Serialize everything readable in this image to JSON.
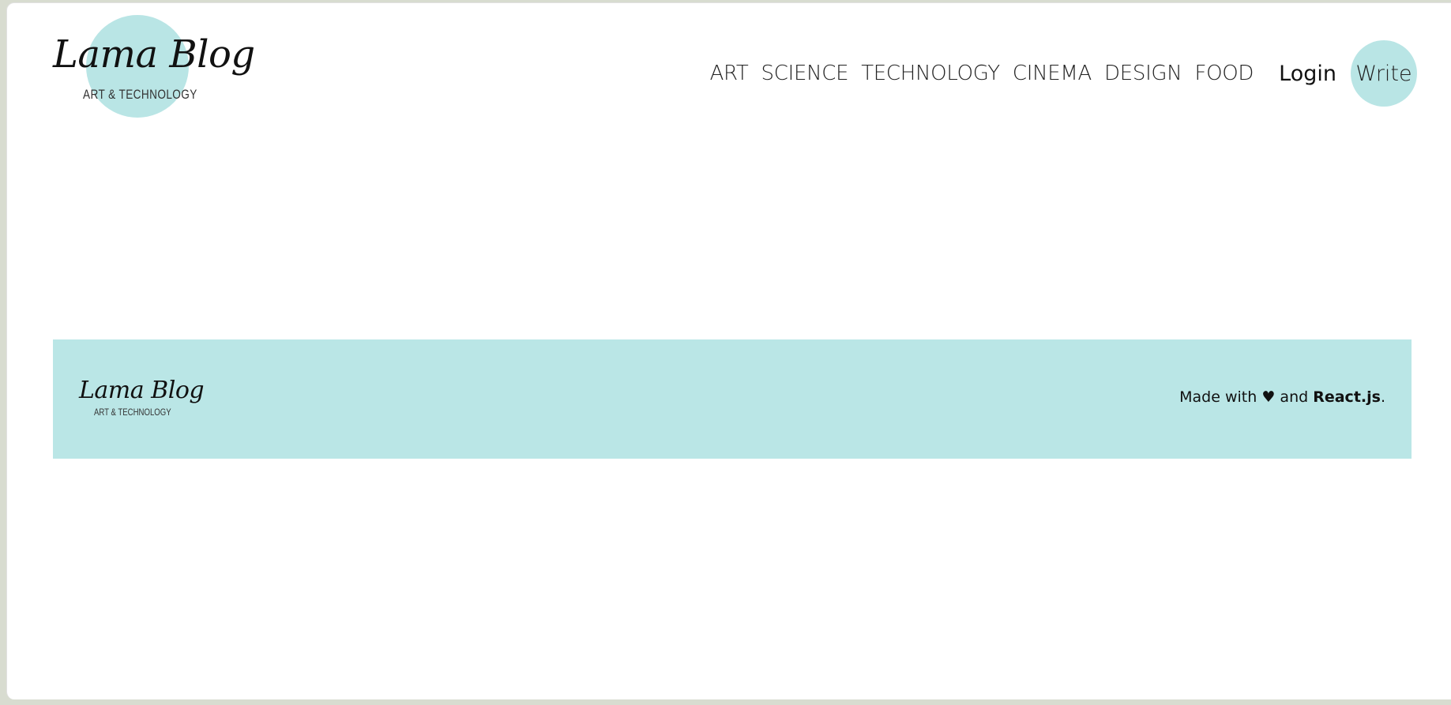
{
  "header": {
    "logo": {
      "title": "Lama Blog",
      "subtitle": "ART & TECHNOLOGY"
    },
    "nav": {
      "links": [
        "ART",
        "SCIENCE",
        "TECHNOLOGY",
        "CINEMA",
        "DESIGN",
        "FOOD"
      ],
      "login_label": "Login",
      "write_label": "Write"
    }
  },
  "footer": {
    "logo": {
      "title": "Lama Blog",
      "subtitle": "ART & TECHNOLOGY"
    },
    "made_with_prefix": "Made with",
    "heart_glyph": "♥",
    "and_text": "and",
    "framework": "React.js",
    "suffix": "."
  },
  "colors": {
    "accent": "#b9e5e5",
    "background": "#ffffff",
    "text": "#111111"
  }
}
